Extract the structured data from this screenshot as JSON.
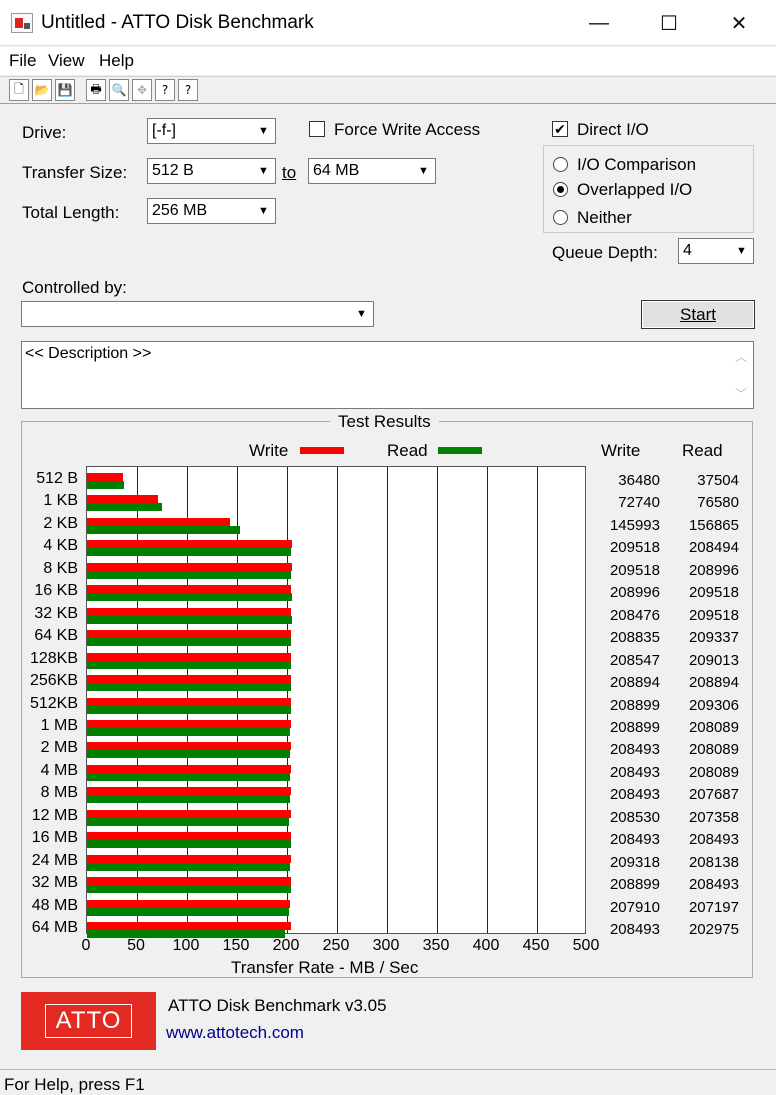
{
  "window": {
    "title": "Untitled - ATTO Disk Benchmark",
    "minimize": "—",
    "maximize": "☐",
    "close": "✕"
  },
  "menu": [
    "File",
    "View",
    "Help"
  ],
  "toolbar": [
    "🗋",
    "📂",
    "💾",
    "🖶",
    "🔍",
    "✥",
    "?",
    "?"
  ],
  "form": {
    "drive_label": "Drive:",
    "drive_value": "[-f-]",
    "transfer_size_label": "Transfer Size:",
    "transfer_from": "512 B",
    "to_label": "to",
    "transfer_to": "64 MB",
    "total_length_label": "Total Length:",
    "total_length_value": "256 MB",
    "force_write_label": "Force Write Access",
    "force_write_checked": false,
    "direct_io_label": "Direct I/O",
    "direct_io_checked": true,
    "io_modes": [
      {
        "label": "I/O Comparison",
        "selected": false
      },
      {
        "label": "Overlapped I/O",
        "selected": true
      },
      {
        "label": "Neither",
        "selected": false
      }
    ],
    "queue_depth_label": "Queue Depth:",
    "queue_depth_value": "4",
    "controlled_by_label": "Controlled by:",
    "controlled_by_value": "",
    "start_label": "Start",
    "description": "<< Description >>"
  },
  "results": {
    "title": "Test Results",
    "legend_write": "Write",
    "legend_read": "Read",
    "col_write": "Write",
    "col_read": "Read",
    "x_label": "Transfer Rate - MB / Sec"
  },
  "colors": {
    "write": "#ff0000",
    "read": "#008000",
    "grid": "#1a1a7a",
    "logo": "#e22a22",
    "link": "#00008b"
  },
  "chart_data": {
    "type": "bar",
    "orientation": "horizontal",
    "categories": [
      "512 B",
      "1 KB",
      "2 KB",
      "4 KB",
      "8 KB",
      "16 KB",
      "32 KB",
      "64 KB",
      "128KB",
      "256KB",
      "512KB",
      "1 MB",
      "2 MB",
      "4 MB",
      "8 MB",
      "12 MB",
      "16 MB",
      "24 MB",
      "32 MB",
      "48 MB",
      "64 MB"
    ],
    "series": [
      {
        "name": "Write",
        "values": [
          36480,
          72740,
          145993,
          209518,
          209518,
          208996,
          208476,
          208835,
          208547,
          208894,
          208899,
          208899,
          208493,
          208493,
          208493,
          208530,
          208493,
          209318,
          208899,
          207910,
          208493
        ]
      },
      {
        "name": "Read",
        "values": [
          37504,
          76580,
          156865,
          208494,
          208996,
          209518,
          209518,
          209337,
          209013,
          208894,
          209306,
          208089,
          208089,
          208089,
          207687,
          207358,
          208493,
          208138,
          208493,
          207197,
          202975
        ]
      }
    ],
    "xlabel": "Transfer Rate - MB / Sec",
    "xlim": [
      0,
      500
    ],
    "xticks": [
      "0",
      "50",
      "100",
      "150",
      "200",
      "250",
      "300",
      "350",
      "400",
      "450",
      "500"
    ],
    "legend": "top",
    "grid": true
  },
  "footer": {
    "logo_text": "ATTO",
    "product": "ATTO Disk Benchmark v3.05",
    "link": "www.attotech.com"
  },
  "status": "For Help, press F1"
}
